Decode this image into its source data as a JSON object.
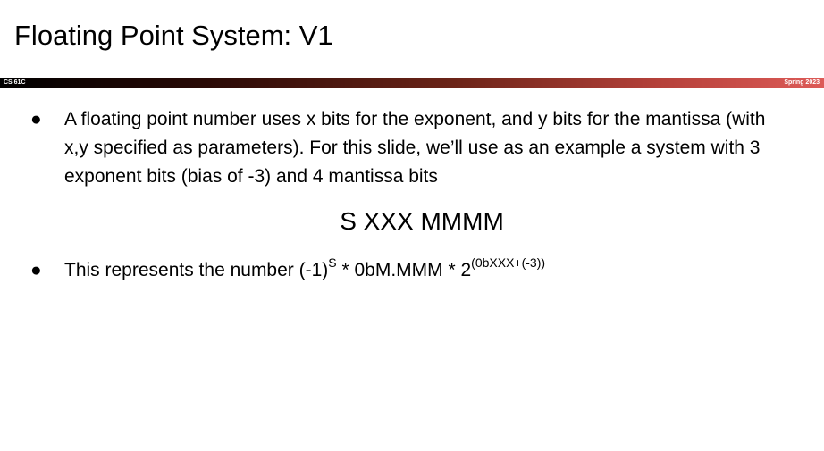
{
  "slide": {
    "title": "Floating Point System: V1",
    "course": "CS 61C",
    "term": "Spring 2023"
  },
  "bullets": [
    {
      "text": "A floating point number uses x bits for the exponent, and y bits for the mantissa (with x,y specified as parameters). For this slide, we’ll use as an example a system with 3 exponent bits (bias of -3) and 4 mantissa bits"
    },
    {
      "text_part1": "This represents the number (-1)",
      "sup1": "S",
      "text_part2": " * 0bM.MMM * 2",
      "sup2": "(0bXXX+(-3))"
    }
  ],
  "format_line": "S XXX MMMM",
  "colors": {
    "band_start": "#000000",
    "band_end": "#dd5a57"
  }
}
